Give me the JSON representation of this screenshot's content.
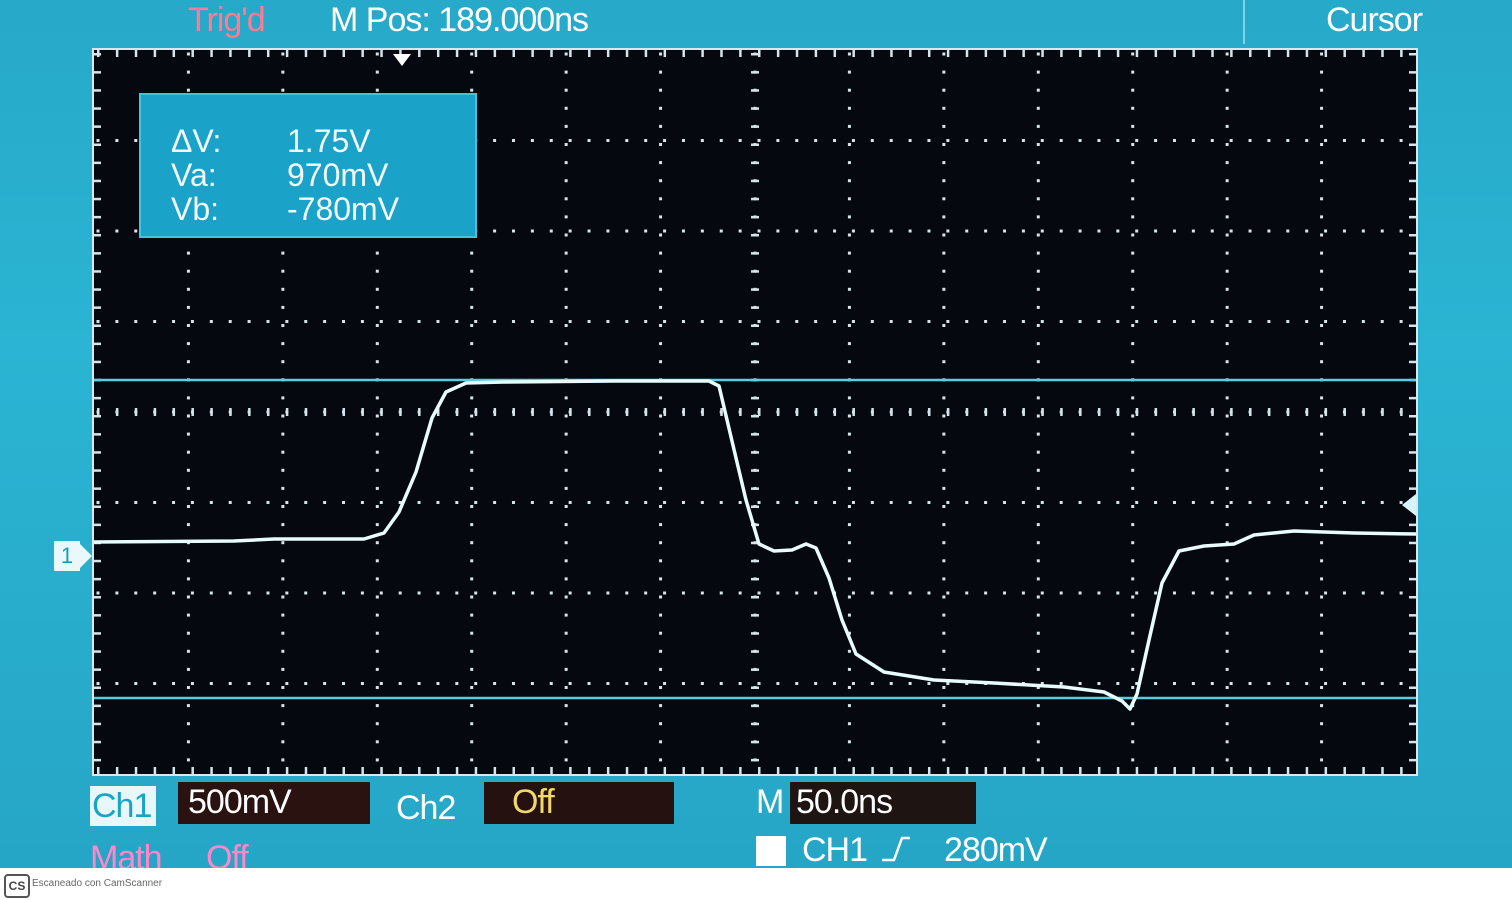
{
  "header": {
    "trigger_status": "Trig'd",
    "m_pos": "M Pos: 189.000ns",
    "menu_title": "Cursor"
  },
  "cursor_readout": {
    "dv_label": "ΔV:",
    "dv_value": "1.75V",
    "va_label": "Va:",
    "va_value": "970mV",
    "vb_label": "Vb:",
    "vb_value": "-780mV"
  },
  "channel_marker": "1",
  "status": {
    "ch1_label": "Ch1",
    "ch1_scale": "500mV",
    "ch2_label": "Ch2",
    "ch2_state": "Off",
    "time_label": "M",
    "time_scale": "50.0ns",
    "math_label": "Math",
    "math_state": "Off",
    "trig_source": "CH1",
    "trig_edge_icon": "rising-edge-icon",
    "trig_level": "280mV"
  },
  "footer": {
    "logo": "CS",
    "text": "Escaneado con CamScanner"
  },
  "colors": {
    "trace": "#e8fbff",
    "cursor_line": "#56cfe6",
    "grid": "#d7e3ea",
    "bezel": "#28aed0",
    "trigger_text": "#ff7b8f",
    "math_text": "#ff86c8",
    "off_text": "#f0d96a"
  }
}
